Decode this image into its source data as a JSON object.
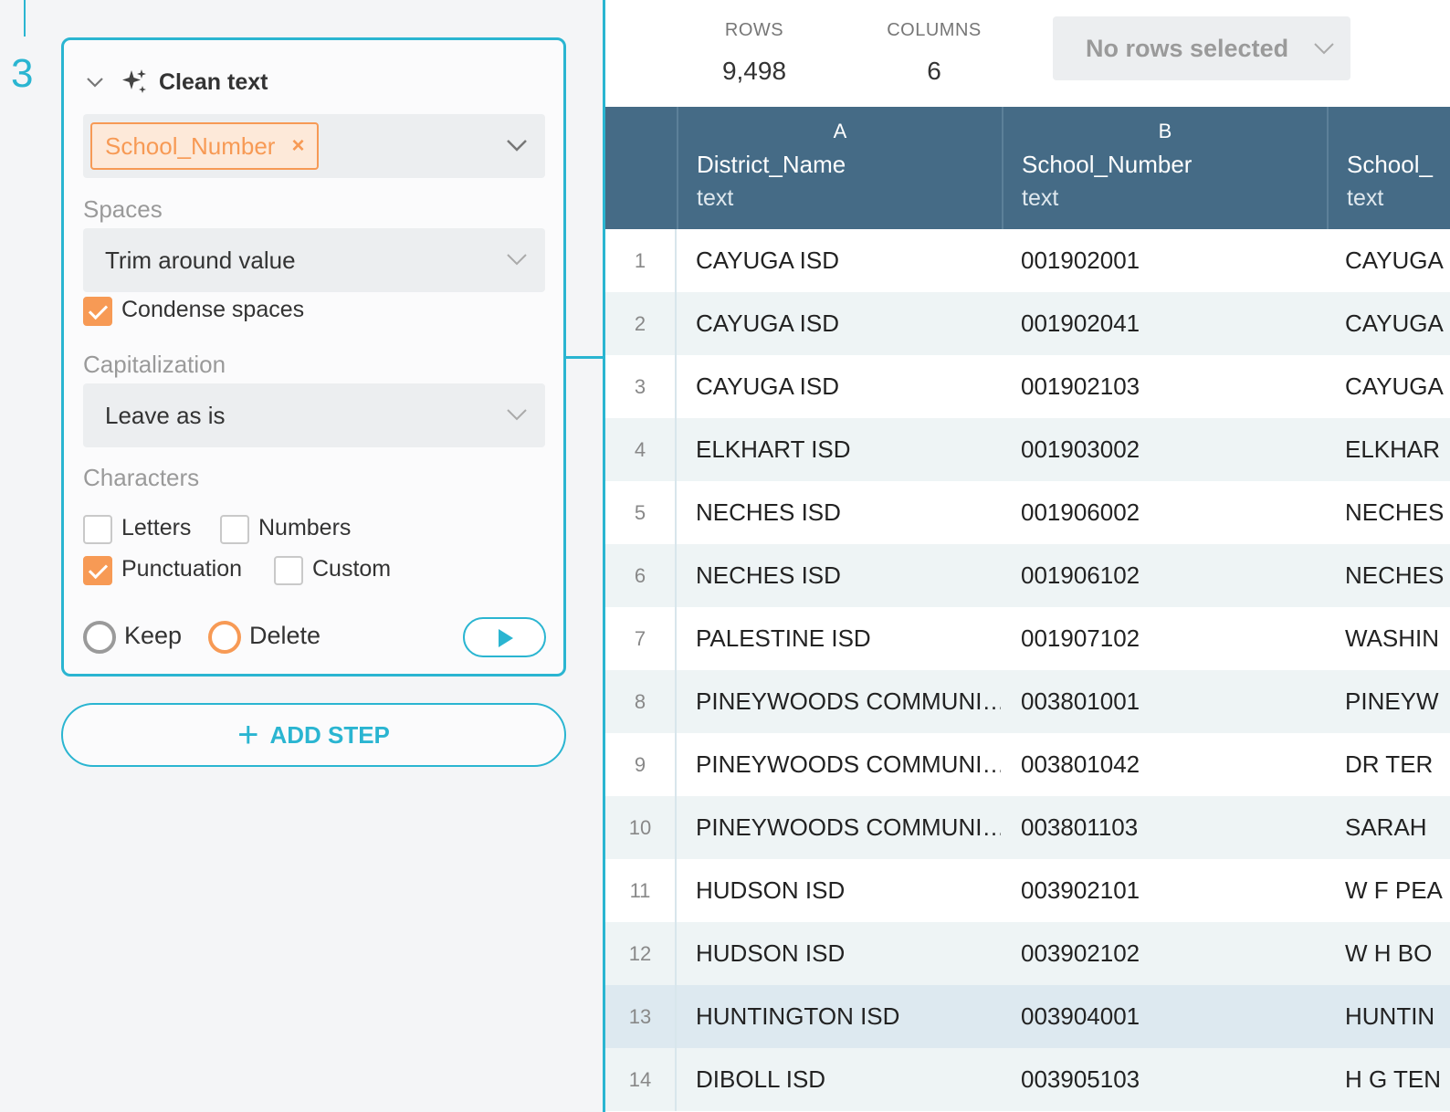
{
  "step": {
    "number": "3",
    "title": "Clean text",
    "selected_column": "School_Number",
    "tag_close": "×",
    "spaces": {
      "label": "Spaces",
      "value": "Trim around value",
      "condense_label": "Condense spaces",
      "condense_checked": true
    },
    "capitalization": {
      "label": "Capitalization",
      "value": "Leave as is"
    },
    "characters": {
      "label": "Characters",
      "letters_label": "Letters",
      "letters_checked": false,
      "numbers_label": "Numbers",
      "numbers_checked": false,
      "punctuation_label": "Punctuation",
      "punctuation_checked": true,
      "custom_label": "Custom",
      "custom_checked": false
    },
    "mode": {
      "keep_label": "Keep",
      "delete_label": "Delete",
      "selected": "Delete"
    }
  },
  "add_step": {
    "plus": "+",
    "label": "ADD STEP"
  },
  "summary": {
    "rows_label": "ROWS",
    "rows_value": "9,498",
    "columns_label": "COLUMNS",
    "columns_value": "6",
    "selection": "No rows selected"
  },
  "table": {
    "columns": [
      {
        "letter": "A",
        "name": "District_Name",
        "type": "text"
      },
      {
        "letter": "B",
        "name": "School_Number",
        "type": "text"
      },
      {
        "letter": "",
        "name": "School_",
        "type": "text"
      }
    ],
    "rows": [
      {
        "num": "1",
        "a": "CAYUGA ISD",
        "b": "001902001",
        "c": "CAYUGA"
      },
      {
        "num": "2",
        "a": "CAYUGA ISD",
        "b": "001902041",
        "c": "CAYUGA"
      },
      {
        "num": "3",
        "a": "CAYUGA ISD",
        "b": "001902103",
        "c": "CAYUGA"
      },
      {
        "num": "4",
        "a": "ELKHART ISD",
        "b": "001903002",
        "c": "ELKHAR"
      },
      {
        "num": "5",
        "a": "NECHES ISD",
        "b": "001906002",
        "c": "NECHES"
      },
      {
        "num": "6",
        "a": "NECHES ISD",
        "b": "001906102",
        "c": "NECHES"
      },
      {
        "num": "7",
        "a": "PALESTINE ISD",
        "b": "001907102",
        "c": "WASHIN"
      },
      {
        "num": "8",
        "a": "PINEYWOODS COMMUNI…",
        "b": "003801001",
        "c": "PINEYW"
      },
      {
        "num": "9",
        "a": "PINEYWOODS COMMUNI…",
        "b": "003801042",
        "c": "DR TER"
      },
      {
        "num": "10",
        "a": "PINEYWOODS COMMUNI…",
        "b": "003801103",
        "c": "SARAH"
      },
      {
        "num": "11",
        "a": "HUDSON ISD",
        "b": "003902101",
        "c": "W F PEA"
      },
      {
        "num": "12",
        "a": "HUDSON ISD",
        "b": "003902102",
        "c": "W H BO"
      },
      {
        "num": "13",
        "a": "HUNTINGTON ISD",
        "b": "003904001",
        "c": "HUNTIN"
      },
      {
        "num": "14",
        "a": "DIBOLL ISD",
        "b": "003905103",
        "c": "H G TEN"
      }
    ],
    "highlighted_row": "13"
  },
  "colors": {
    "accent": "#2ab5d1",
    "tag_orange": "#f79a55",
    "header_bg": "#456b86"
  }
}
